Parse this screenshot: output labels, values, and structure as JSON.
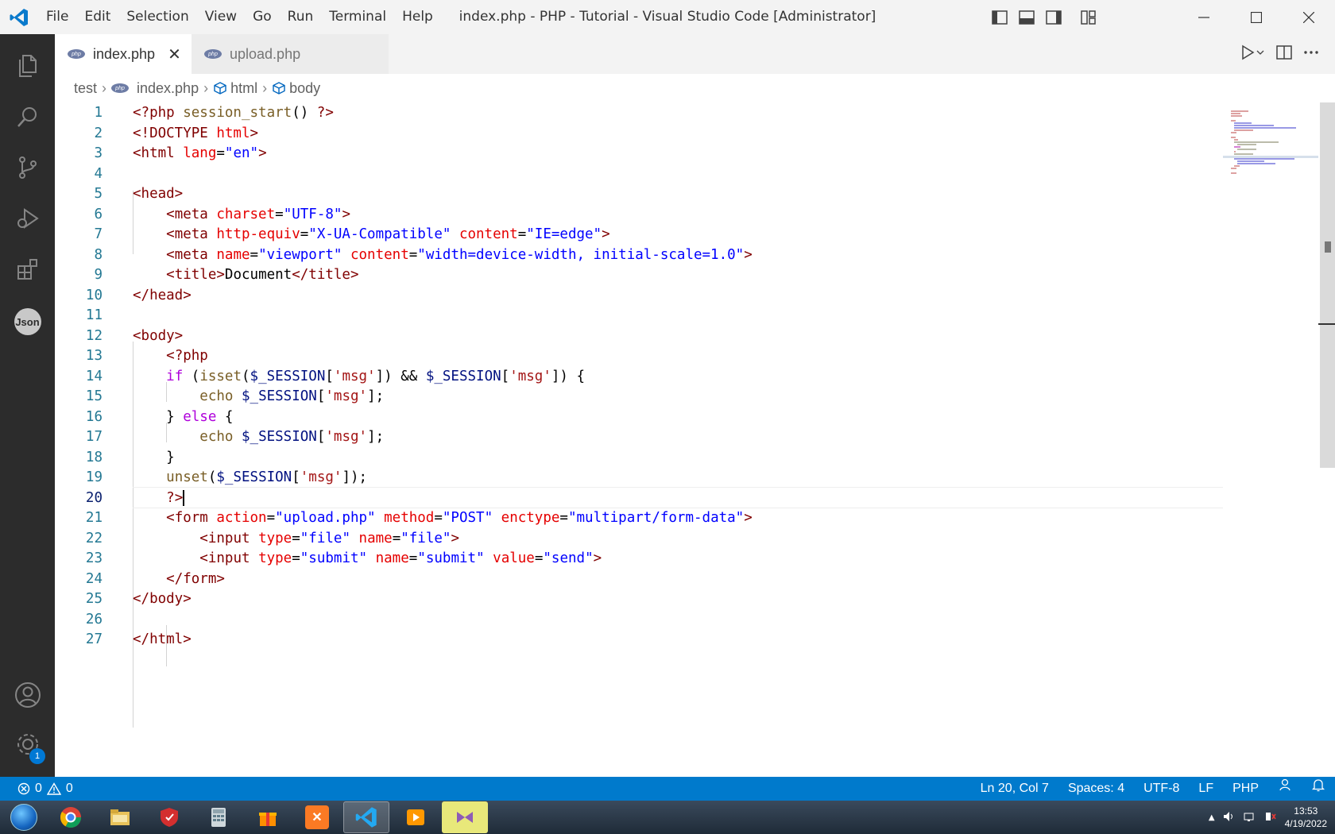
{
  "window": {
    "title": "index.php - PHP - Tutorial - Visual Studio Code [Administrator]",
    "menu": [
      "File",
      "Edit",
      "Selection",
      "View",
      "Go",
      "Run",
      "Terminal",
      "Help"
    ]
  },
  "activity_bar": {
    "items": [
      "explorer-icon",
      "search-icon",
      "source-control-icon",
      "run-debug-icon",
      "extensions-icon",
      "json-extension-icon"
    ],
    "json_label": "Json",
    "bottom": [
      "account-icon",
      "settings-icon"
    ],
    "settings_badge": "1"
  },
  "tabs": [
    {
      "label": "index.php",
      "active": true,
      "icon_text": "php"
    },
    {
      "label": "upload.php",
      "active": false,
      "icon_text": "php"
    }
  ],
  "breadcrumb": [
    "test",
    "index.php",
    "html",
    "body"
  ],
  "editor": {
    "current_line": 20,
    "lines": [
      {
        "n": "1",
        "tokens": [
          [
            "t-php",
            "<?php "
          ],
          [
            "t-fn",
            "session_start"
          ],
          [
            "t-txt",
            "() "
          ],
          [
            "t-php",
            "?>"
          ]
        ]
      },
      {
        "n": "2",
        "tokens": [
          [
            "t-tag",
            "<!DOCTYPE "
          ],
          [
            "t-attr",
            "html"
          ],
          [
            "t-tag",
            ">"
          ]
        ]
      },
      {
        "n": "3",
        "tokens": [
          [
            "t-tag",
            "<html "
          ],
          [
            "t-attr",
            "lang"
          ],
          [
            "t-txt",
            "="
          ],
          [
            "t-str",
            "\"en\""
          ],
          [
            "t-tag",
            ">"
          ]
        ]
      },
      {
        "n": "4",
        "tokens": []
      },
      {
        "n": "5",
        "tokens": [
          [
            "t-tag",
            "<head>"
          ]
        ]
      },
      {
        "n": "6",
        "tokens": [
          [
            "t-txt",
            "    "
          ],
          [
            "t-tag",
            "<meta "
          ],
          [
            "t-attr",
            "charset"
          ],
          [
            "t-txt",
            "="
          ],
          [
            "t-str",
            "\"UTF-8\""
          ],
          [
            "t-tag",
            ">"
          ]
        ]
      },
      {
        "n": "7",
        "tokens": [
          [
            "t-txt",
            "    "
          ],
          [
            "t-tag",
            "<meta "
          ],
          [
            "t-attr",
            "http-equiv"
          ],
          [
            "t-txt",
            "="
          ],
          [
            "t-str",
            "\"X-UA-Compatible\""
          ],
          [
            "t-txt",
            " "
          ],
          [
            "t-attr",
            "content"
          ],
          [
            "t-txt",
            "="
          ],
          [
            "t-str",
            "\"IE=edge\""
          ],
          [
            "t-tag",
            ">"
          ]
        ]
      },
      {
        "n": "8",
        "tokens": [
          [
            "t-txt",
            "    "
          ],
          [
            "t-tag",
            "<meta "
          ],
          [
            "t-attr",
            "name"
          ],
          [
            "t-txt",
            "="
          ],
          [
            "t-str",
            "\"viewport\""
          ],
          [
            "t-txt",
            " "
          ],
          [
            "t-attr",
            "content"
          ],
          [
            "t-txt",
            "="
          ],
          [
            "t-str",
            "\"width=device-width, initial-scale=1.0\""
          ],
          [
            "t-tag",
            ">"
          ]
        ]
      },
      {
        "n": "9",
        "tokens": [
          [
            "t-txt",
            "    "
          ],
          [
            "t-tag",
            "<title>"
          ],
          [
            "t-txt",
            "Document"
          ],
          [
            "t-tag",
            "</title>"
          ]
        ]
      },
      {
        "n": "10",
        "tokens": [
          [
            "t-tag",
            "</head>"
          ]
        ]
      },
      {
        "n": "11",
        "tokens": []
      },
      {
        "n": "12",
        "tokens": [
          [
            "t-tag",
            "<body>"
          ]
        ]
      },
      {
        "n": "13",
        "tokens": [
          [
            "t-txt",
            "    "
          ],
          [
            "t-php",
            "<?php"
          ]
        ]
      },
      {
        "n": "14",
        "tokens": [
          [
            "t-txt",
            "    "
          ],
          [
            "t-kw",
            "if"
          ],
          [
            "t-txt",
            " ("
          ],
          [
            "t-fn",
            "isset"
          ],
          [
            "t-txt",
            "("
          ],
          [
            "t-var",
            "$_SESSION"
          ],
          [
            "t-txt",
            "["
          ],
          [
            "t-pstr",
            "'msg'"
          ],
          [
            "t-txt",
            "]) && "
          ],
          [
            "t-var",
            "$_SESSION"
          ],
          [
            "t-txt",
            "["
          ],
          [
            "t-pstr",
            "'msg'"
          ],
          [
            "t-txt",
            "]) {"
          ]
        ]
      },
      {
        "n": "15",
        "tokens": [
          [
            "t-txt",
            "        "
          ],
          [
            "t-fn",
            "echo"
          ],
          [
            "t-txt",
            " "
          ],
          [
            "t-var",
            "$_SESSION"
          ],
          [
            "t-txt",
            "["
          ],
          [
            "t-pstr",
            "'msg'"
          ],
          [
            "t-txt",
            "];"
          ]
        ]
      },
      {
        "n": "16",
        "tokens": [
          [
            "t-txt",
            "    } "
          ],
          [
            "t-kw",
            "else"
          ],
          [
            "t-txt",
            " {"
          ]
        ]
      },
      {
        "n": "17",
        "tokens": [
          [
            "t-txt",
            "        "
          ],
          [
            "t-fn",
            "echo"
          ],
          [
            "t-txt",
            " "
          ],
          [
            "t-var",
            "$_SESSION"
          ],
          [
            "t-txt",
            "["
          ],
          [
            "t-pstr",
            "'msg'"
          ],
          [
            "t-txt",
            "];"
          ]
        ]
      },
      {
        "n": "18",
        "tokens": [
          [
            "t-txt",
            "    }"
          ]
        ]
      },
      {
        "n": "19",
        "tokens": [
          [
            "t-txt",
            "    "
          ],
          [
            "t-fn",
            "unset"
          ],
          [
            "t-txt",
            "("
          ],
          [
            "t-var",
            "$_SESSION"
          ],
          [
            "t-txt",
            "["
          ],
          [
            "t-pstr",
            "'msg'"
          ],
          [
            "t-txt",
            "]);"
          ]
        ]
      },
      {
        "n": "20",
        "tokens": [
          [
            "t-txt",
            "    "
          ],
          [
            "t-php",
            "?>"
          ]
        ]
      },
      {
        "n": "21",
        "tokens": [
          [
            "t-txt",
            "    "
          ],
          [
            "t-tag",
            "<form "
          ],
          [
            "t-attr",
            "action"
          ],
          [
            "t-txt",
            "="
          ],
          [
            "t-str",
            "\"upload.php\""
          ],
          [
            "t-txt",
            " "
          ],
          [
            "t-attr",
            "method"
          ],
          [
            "t-txt",
            "="
          ],
          [
            "t-str",
            "\"POST\""
          ],
          [
            "t-txt",
            " "
          ],
          [
            "t-attr",
            "enctype"
          ],
          [
            "t-txt",
            "="
          ],
          [
            "t-str",
            "\"multipart/form-data\""
          ],
          [
            "t-tag",
            ">"
          ]
        ]
      },
      {
        "n": "22",
        "tokens": [
          [
            "t-txt",
            "        "
          ],
          [
            "t-tag",
            "<input "
          ],
          [
            "t-attr",
            "type"
          ],
          [
            "t-txt",
            "="
          ],
          [
            "t-str",
            "\"file\""
          ],
          [
            "t-txt",
            " "
          ],
          [
            "t-attr",
            "name"
          ],
          [
            "t-txt",
            "="
          ],
          [
            "t-str",
            "\"file\""
          ],
          [
            "t-tag",
            ">"
          ]
        ]
      },
      {
        "n": "23",
        "tokens": [
          [
            "t-txt",
            "        "
          ],
          [
            "t-tag",
            "<input "
          ],
          [
            "t-attr",
            "type"
          ],
          [
            "t-txt",
            "="
          ],
          [
            "t-str",
            "\"submit\""
          ],
          [
            "t-txt",
            " "
          ],
          [
            "t-attr",
            "name"
          ],
          [
            "t-txt",
            "="
          ],
          [
            "t-str",
            "\"submit\""
          ],
          [
            "t-txt",
            " "
          ],
          [
            "t-attr",
            "value"
          ],
          [
            "t-txt",
            "="
          ],
          [
            "t-str",
            "\"send\""
          ],
          [
            "t-tag",
            ">"
          ]
        ]
      },
      {
        "n": "24",
        "tokens": [
          [
            "t-txt",
            "    "
          ],
          [
            "t-tag",
            "</form>"
          ]
        ]
      },
      {
        "n": "25",
        "tokens": [
          [
            "t-tag",
            "</body>"
          ]
        ]
      },
      {
        "n": "26",
        "tokens": []
      },
      {
        "n": "27",
        "tokens": [
          [
            "t-tag",
            "</html>"
          ]
        ]
      }
    ]
  },
  "status": {
    "errors": "0",
    "warnings": "0",
    "position": "Ln 20, Col 7",
    "spaces": "Spaces: 4",
    "encoding": "UTF-8",
    "eol": "LF",
    "language": "PHP"
  },
  "taskbar": {
    "apps": [
      "chrome-icon",
      "file-explorer-icon",
      "shield-app-icon",
      "calculator-icon",
      "gift-app-icon",
      "xampp-icon",
      "vscode-icon",
      "media-player-icon",
      "visual-studio-icon"
    ],
    "time": "13:53",
    "date": "4/19/2022"
  },
  "colors": {
    "accent": "#007acc",
    "activity_bg": "#2c2c2c",
    "titlebar_bg": "#f3f3f3"
  }
}
